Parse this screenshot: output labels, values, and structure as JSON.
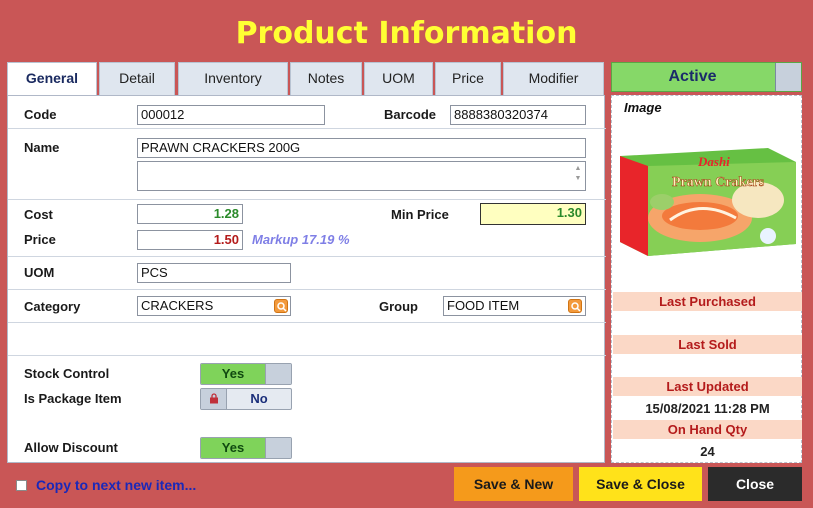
{
  "window": {
    "title": "Product Information"
  },
  "tabs": [
    {
      "label": "General"
    },
    {
      "label": "Detail"
    },
    {
      "label": "Inventory"
    },
    {
      "label": "Notes"
    },
    {
      "label": "UOM"
    },
    {
      "label": "Price"
    },
    {
      "label": "Modifier"
    }
  ],
  "form": {
    "code_label": "Code",
    "code_value": "000012",
    "barcode_label": "Barcode",
    "barcode_value": "8888380320374",
    "name_label": "Name",
    "name_value": "PRAWN CRACKERS 200G",
    "name2_value": "",
    "cost_label": "Cost",
    "cost_value": "1.28",
    "min_price_label": "Min Price",
    "min_price_value": "1.30",
    "price_label": "Price",
    "price_value": "1.50",
    "markup_text": "Markup 17.19 %",
    "uom_label": "UOM",
    "uom_value": "PCS",
    "category_label": "Category",
    "category_value": "CRACKERS",
    "group_label": "Group",
    "group_value": "FOOD ITEM",
    "stock_control_label": "Stock Control",
    "stock_control_value": "Yes",
    "package_label": "Is Package Item",
    "package_value": "No",
    "allow_discount_label": "Allow Discount",
    "allow_discount_value": "Yes"
  },
  "status": {
    "active_label": "Active"
  },
  "side": {
    "image_label": "Image",
    "image_brand": "Dashi",
    "image_product": "Prawn Crakers",
    "last_purchased_label": "Last Purchased",
    "last_purchased_value": "",
    "last_sold_label": "Last Sold",
    "last_sold_value": "",
    "last_updated_label": "Last Updated",
    "last_updated_value": "15/08/2021 11:28 PM",
    "on_hand_label": "On Hand Qty",
    "on_hand_value": "24"
  },
  "footer": {
    "copy_label": "Copy to next new item...",
    "save_new_label": "Save & New",
    "save_close_label": "Save & Close",
    "close_label": "Close"
  },
  "colors": {
    "frame": "#c95656",
    "title": "#ffff33",
    "active": "#86d868",
    "save_new": "#f59a1b",
    "save_close": "#ffe21a",
    "close": "#2b2b2b",
    "info_header": "#fbd8c6"
  }
}
